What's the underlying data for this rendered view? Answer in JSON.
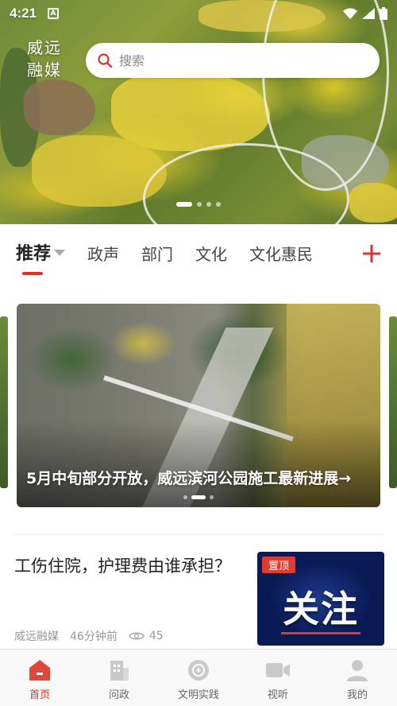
{
  "status_bar": {
    "time": "4:21",
    "app_badge": "A"
  },
  "header": {
    "brand_line1": "威远",
    "brand_line2": "融媒",
    "search_placeholder": "搜索"
  },
  "tabs": [
    {
      "label": "推荐",
      "active": true
    },
    {
      "label": "政声"
    },
    {
      "label": "部门"
    },
    {
      "label": "文化"
    },
    {
      "label": "文化惠民"
    }
  ],
  "banner": {
    "title": "5月中旬部分开放，威远滨河公园施工最新进展→"
  },
  "news": [
    {
      "title": "工伤住院，护理费由谁承担？",
      "source": "威远融媒",
      "time": "46分钟前",
      "views": "45",
      "thumb_badge": "置顶",
      "thumb_text": "关注"
    }
  ],
  "bottom_nav": [
    {
      "label": "首页",
      "icon": "home-icon",
      "active": true
    },
    {
      "label": "问政",
      "icon": "building-icon"
    },
    {
      "label": "文明实践",
      "icon": "civilization-icon"
    },
    {
      "label": "视听",
      "icon": "video-camera-icon"
    },
    {
      "label": "我的",
      "icon": "user-icon"
    }
  ],
  "colors": {
    "accent": "#d9342b",
    "pin_badge": "#e23b2e"
  }
}
